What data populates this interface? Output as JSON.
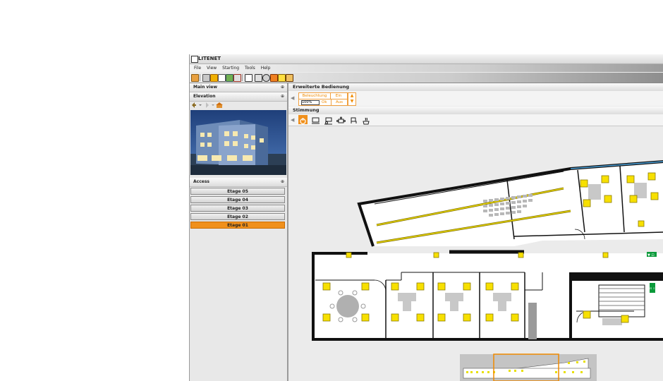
{
  "window": {
    "title": "LITENET"
  },
  "menu": [
    "File",
    "View",
    "Starting",
    "Tools",
    "Help"
  ],
  "toolbar": {
    "icons": [
      "folder-open-icon",
      "settings-icon",
      "warning-icon",
      "document-icon",
      "chart-icon",
      "exit-icon",
      "window-icon",
      "building-icon",
      "network-icon",
      "log-icon",
      "light-icon",
      "tools-icon"
    ]
  },
  "sidebar": {
    "main_view": {
      "label": "Main view",
      "pin": "⊕"
    },
    "elevation": {
      "label": "Elevation",
      "pin": "⊕"
    },
    "access": {
      "label": "Access",
      "pin": "⊕"
    },
    "floors": [
      {
        "label": "Etage 05",
        "selected": false
      },
      {
        "label": "Etage 04",
        "selected": false
      },
      {
        "label": "Etage 03",
        "selected": false
      },
      {
        "label": "Etage 02",
        "selected": false
      },
      {
        "label": "Etage 01",
        "selected": true
      }
    ]
  },
  "panel": {
    "title": "Erweiterte Bedienung",
    "beleuchtung": "Beleuchtung",
    "ein": "Ein",
    "percent": "100%",
    "ok": "Ok",
    "aus": "Aus"
  },
  "mood": {
    "title": "Stimmung",
    "icons": [
      "power-icon",
      "workstation-icon",
      "presentation-icon",
      "meeting-icon",
      "chair-icon",
      "coffee-icon"
    ]
  },
  "plan": {
    "exit_sign_1": "▼ ⊡",
    "exit_sign_2": "⊡ ⇩"
  },
  "colors": {
    "accent": "#f0901c",
    "light": "#f7e000",
    "wall": "#111111",
    "track": "#d4c000"
  }
}
